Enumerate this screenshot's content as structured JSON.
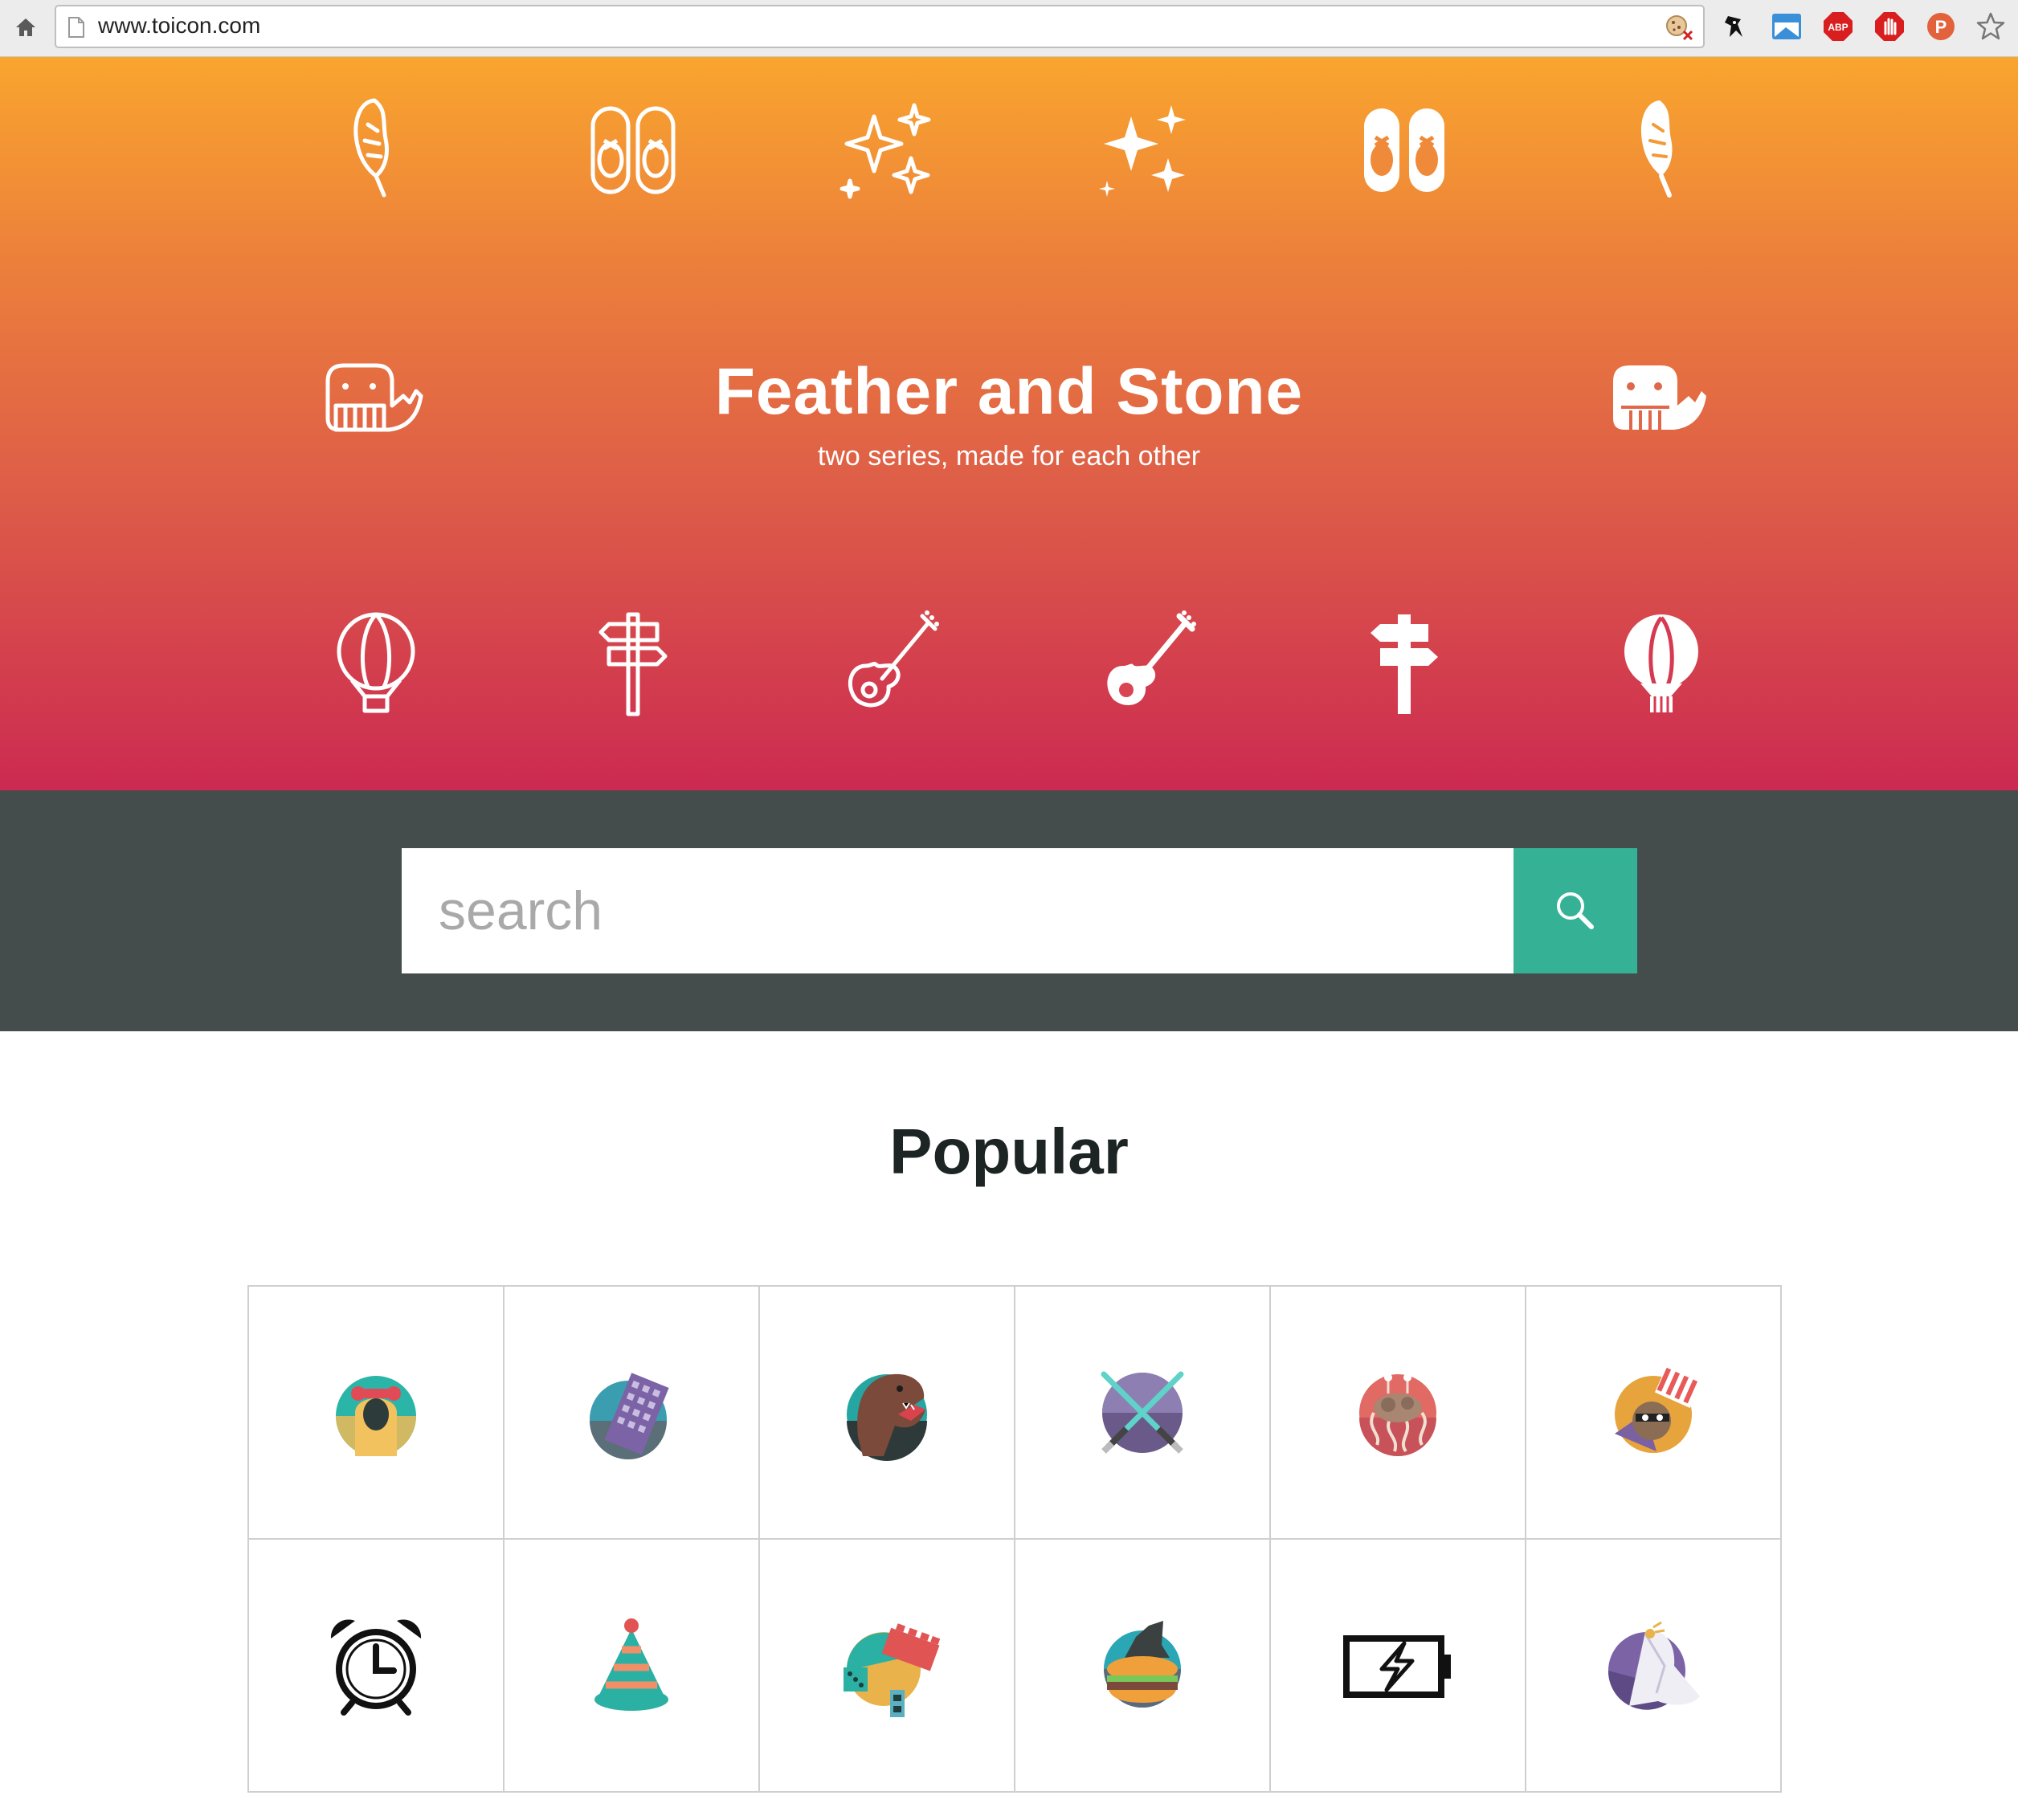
{
  "browser": {
    "url": "www.toicon.com",
    "extensions": [
      "ninja-icon",
      "window-extension-icon",
      "abp-icon",
      "stop-hand-icon",
      "p-badge-icon",
      "bookmark-star-icon"
    ]
  },
  "hero": {
    "title": "Feather and Stone",
    "subtitle": "two series, made for each other",
    "icons_top": [
      "feather-outline-icon",
      "ballet-shoes-outline-icon",
      "sparkles-outline-icon",
      "sparkles-solid-icon",
      "ballet-shoes-solid-icon",
      "feather-solid-icon"
    ],
    "icons_middle": [
      "whale-outline-icon",
      "whale-solid-icon"
    ],
    "icons_bottom": [
      "hot-air-balloon-outline-icon",
      "signpost-outline-icon",
      "guitar-outline-icon",
      "guitar-solid-icon",
      "signpost-solid-icon",
      "hot-air-balloon-solid-icon"
    ],
    "colors": {
      "gradient_top": "#f9a52e",
      "gradient_bottom": "#cc2a51"
    }
  },
  "search": {
    "placeholder": "search",
    "button_icon": "search-icon",
    "colors": {
      "band": "#454d4c",
      "button": "#35b295"
    }
  },
  "popular": {
    "title": "Popular",
    "icons": [
      "hooded-figure-icon",
      "tilted-building-icon",
      "t-rex-icon",
      "crossed-lightsabers-icon",
      "flying-spaghetti-monster-icon",
      "bandit-sloth-icon",
      "alarm-clock-icon",
      "party-hat-icon",
      "toy-bricks-icon",
      "burger-mountain-icon",
      "battery-charging-icon",
      "bride-veil-icon"
    ]
  }
}
